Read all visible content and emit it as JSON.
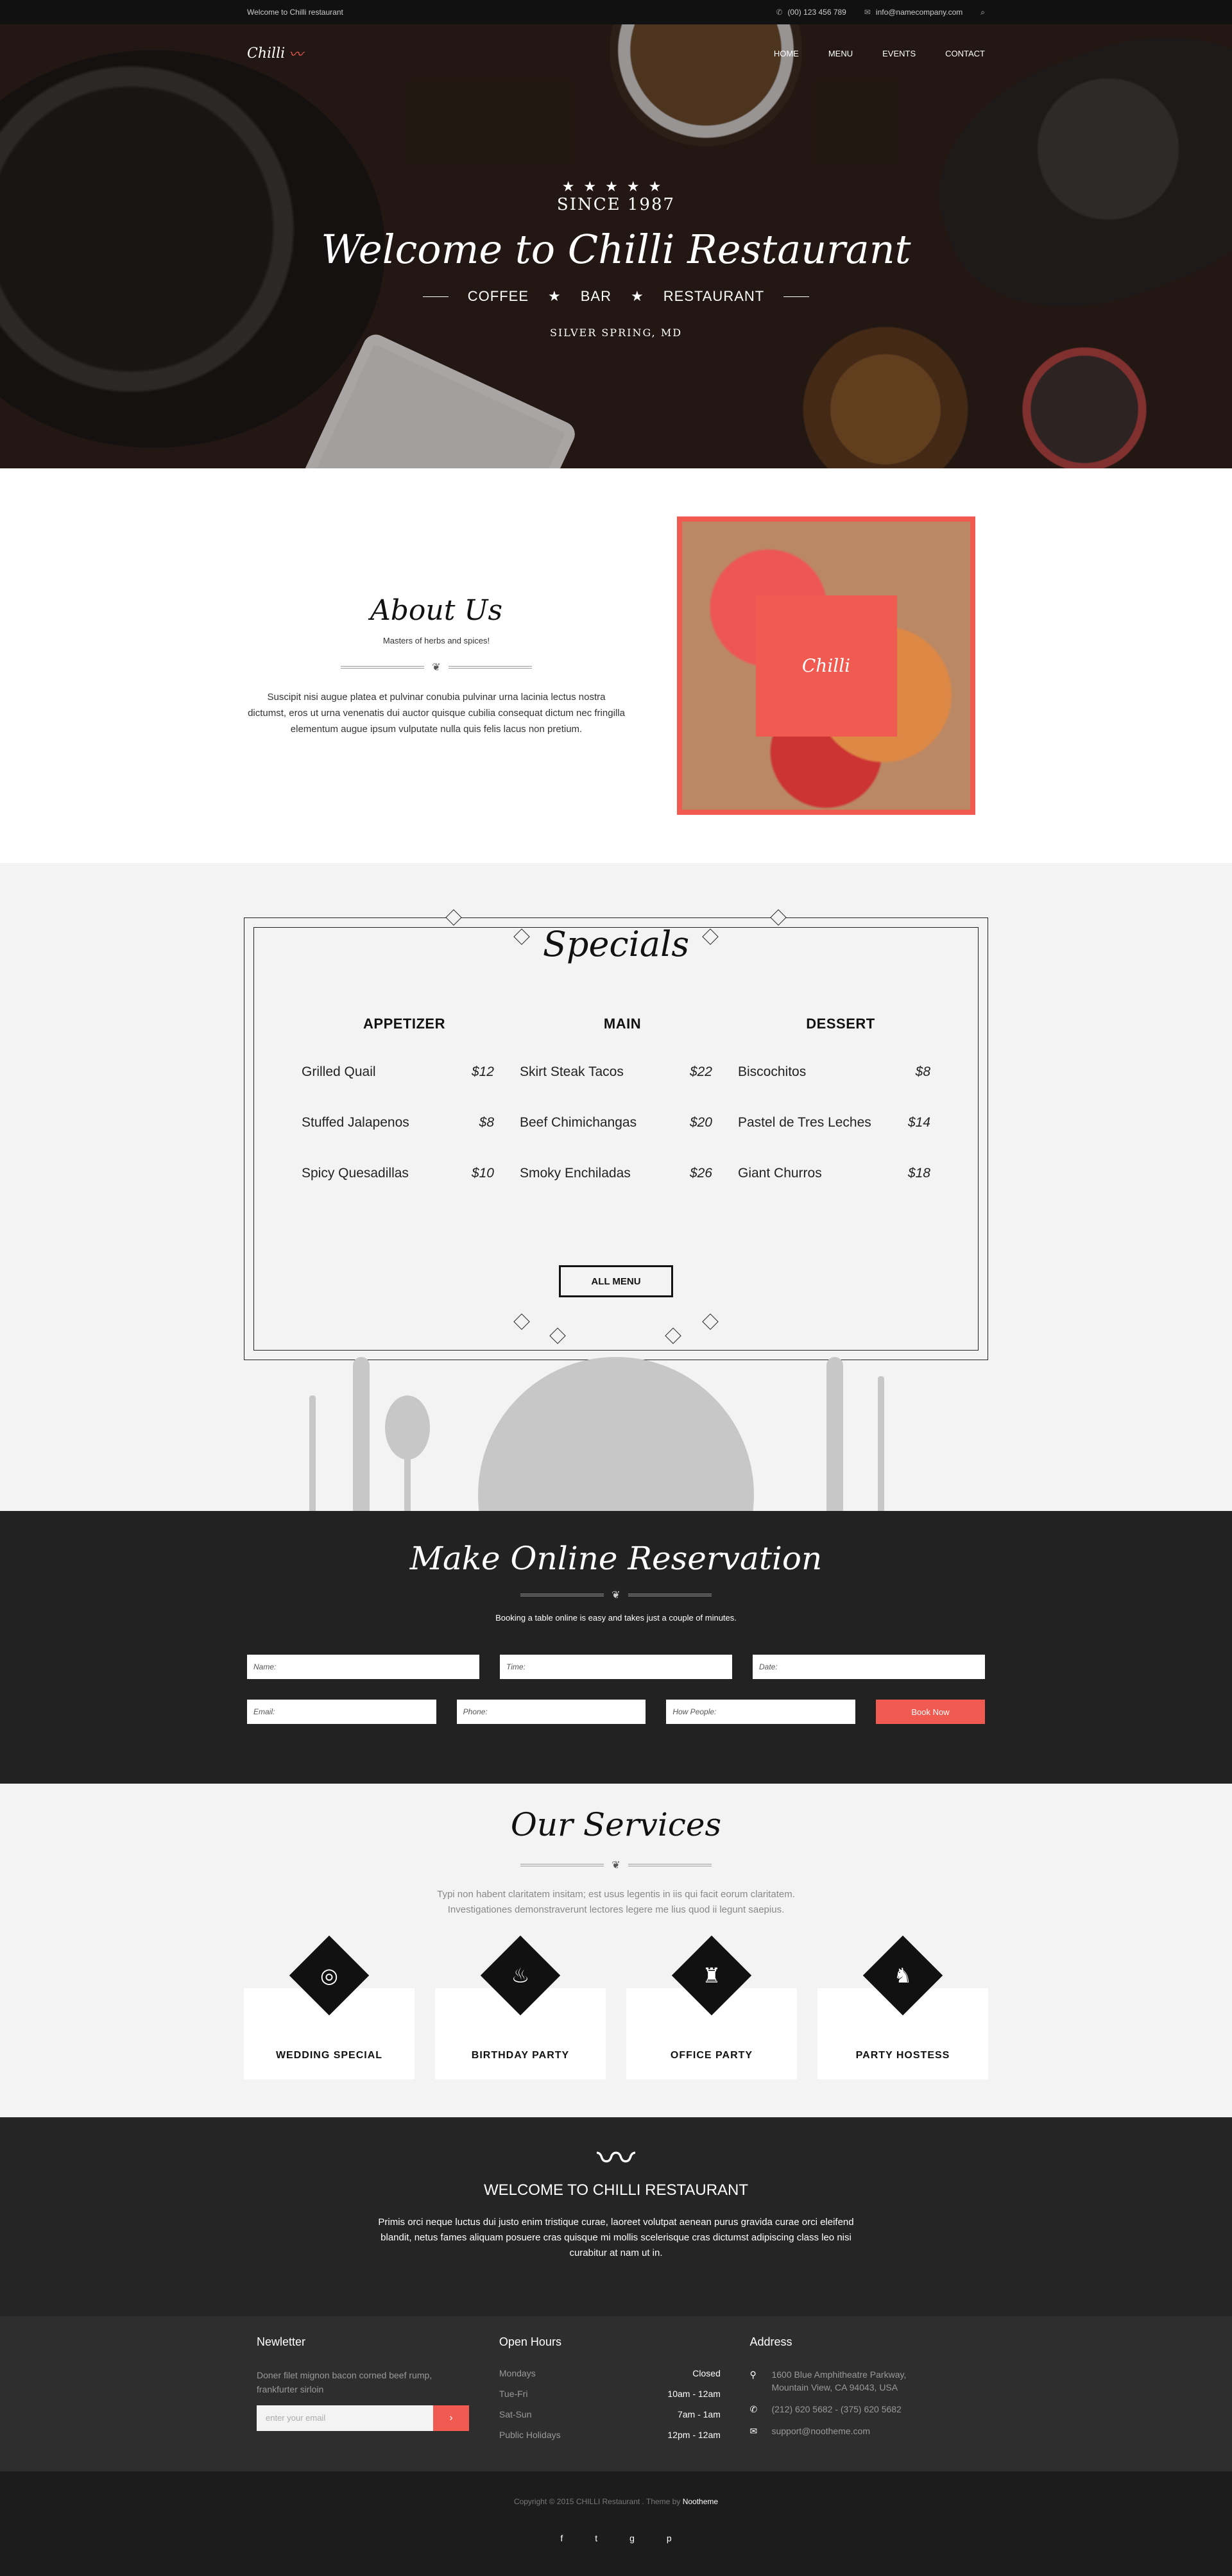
{
  "topbar": {
    "welcome": "Welcome to Chilli restaurant",
    "phone": "(00) 123 456 789",
    "email": "info@namecompany.com"
  },
  "brand": {
    "logo_text": "Chilli"
  },
  "nav": [
    "HOME",
    "MENU",
    "EVENTS",
    "CONTACT"
  ],
  "hero": {
    "since": "SINCE 1987",
    "title": "Welcome to Chilli Restaurant",
    "tags": [
      "COFFEE",
      "BAR",
      "RESTAURANT"
    ],
    "location": "SILVER SPRING, MD"
  },
  "about": {
    "title": "About Us",
    "subtitle": "Masters of herbs and spices!",
    "body": "Suscipit nisi augue platea et pulvinar conubia pulvinar urna lacinia lectus nostra dictumst, eros ut urna venenatis dui auctor quisque cubilia consequat dictum nec fringilla elementum augue ipsum vulputate nulla quis felis lacus non pretium.",
    "badge": "Chilli"
  },
  "specials": {
    "title": "Specials",
    "columns": [
      {
        "heading": "APPETIZER",
        "items": [
          {
            "name": "Grilled Quail",
            "price": "$12"
          },
          {
            "name": "Stuffed Jalapenos",
            "price": "$8"
          },
          {
            "name": "Spicy Quesadillas",
            "price": "$10"
          }
        ]
      },
      {
        "heading": "MAIN",
        "items": [
          {
            "name": "Skirt Steak Tacos",
            "price": "$22"
          },
          {
            "name": "Beef Chimichangas",
            "price": "$20"
          },
          {
            "name": "Smoky Enchiladas",
            "price": "$26"
          }
        ]
      },
      {
        "heading": "DESSERT",
        "items": [
          {
            "name": "Biscochitos",
            "price": "$8"
          },
          {
            "name": "Pastel de Tres Leches",
            "price": "$14"
          },
          {
            "name": "Giant Churros",
            "price": "$18"
          }
        ]
      }
    ],
    "button": "ALL MENU"
  },
  "reservation": {
    "title": "Make Online Reservation",
    "subtitle": "Booking a table online is easy and takes just a couple of minutes.",
    "fields": {
      "name": "Name:",
      "time": "Time:",
      "date": "Date:",
      "email": "Email:",
      "phone": "Phone:",
      "people": "How People:"
    },
    "button": "Book Now"
  },
  "services": {
    "title": "Our Services",
    "subtitle_1": "Typi non habent claritatem insitam; est usus legentis in iis qui facit eorum claritatem.",
    "subtitle_2": "Investigationes demonstraverunt lectores legere me lius quod ii legunt saepius.",
    "items": [
      {
        "label": "WEDDING SPECIAL",
        "icon": "rings-icon"
      },
      {
        "label": "BIRTHDAY PARTY",
        "icon": "cake-icon"
      },
      {
        "label": "OFFICE PARTY",
        "icon": "office-icon"
      },
      {
        "label": "PARTY HOSTESS",
        "icon": "hostess-icon"
      }
    ]
  },
  "welcome": {
    "title": "WELCOME TO CHILLI RESTAURANT",
    "body": "Primis orci neque luctus dui justo enim tristique curae, laoreet volutpat aenean purus gravida curae orci eleifend blandit, netus fames aliquam posuere cras quisque mi mollis scelerisque cras dictumst adipiscing class leo nisi curabitur at nam ut in."
  },
  "footer": {
    "newsletter": {
      "title": "Newletter",
      "text": "Doner filet mignon bacon corned beef rump, frankfurter sirloin",
      "placeholder": "enter your email"
    },
    "hours": {
      "title": "Open Hours",
      "rows": [
        {
          "day": "Mondays",
          "time": "Closed"
        },
        {
          "day": "Tue-Fri",
          "time": "10am - 12am"
        },
        {
          "day": "Sat-Sun",
          "time": "7am - 1am"
        },
        {
          "day": "Public Holidays",
          "time": "12pm - 12am"
        }
      ]
    },
    "address": {
      "title": "Address",
      "line1": "1600 Blue Amphitheatre Parkway,",
      "line2": "Mountain View, CA 94043, USA",
      "phones": "(212) 620 5682  -  (375) 620 5682",
      "email": "support@nootheme.com"
    },
    "copyright": "Copyright © 2015 CHILLI Restaurant . Theme by",
    "theme_by": "Nootheme",
    "socials": [
      "facebook-icon",
      "twitter-icon",
      "google-plus-icon",
      "pinterest-icon"
    ]
  }
}
